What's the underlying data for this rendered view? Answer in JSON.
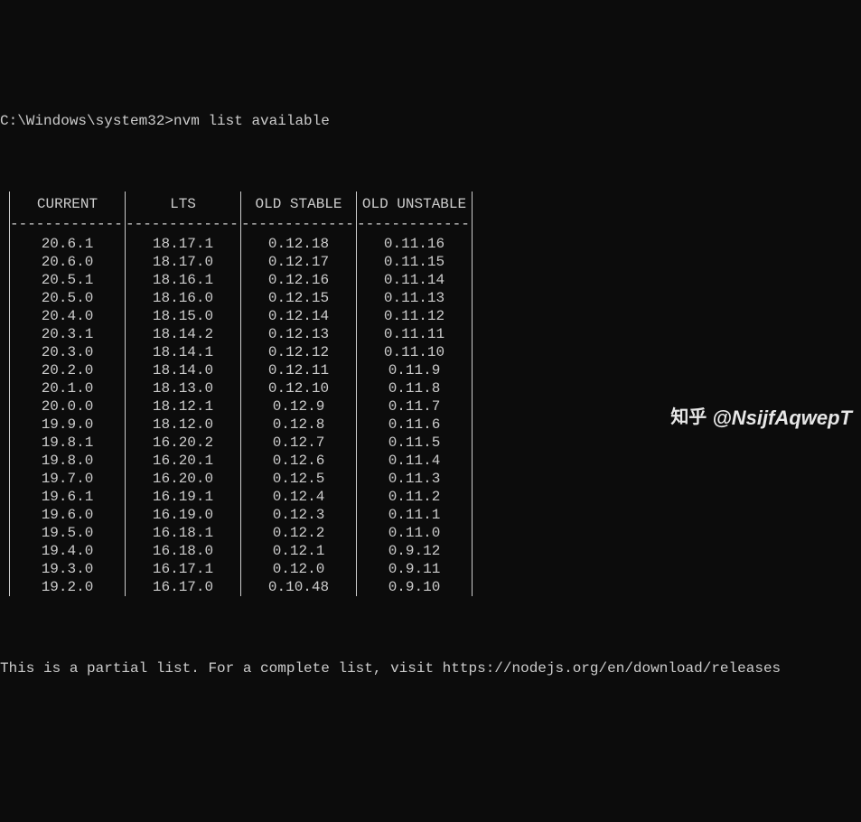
{
  "prompt": {
    "cwd": "C:\\Windows\\system32>",
    "command": "nvm list available"
  },
  "table": {
    "columns": [
      {
        "header": "CURRENT",
        "rows": [
          "20.6.1",
          "20.6.0",
          "20.5.1",
          "20.5.0",
          "20.4.0",
          "20.3.1",
          "20.3.0",
          "20.2.0",
          "20.1.0",
          "20.0.0",
          "19.9.0",
          "19.8.1",
          "19.8.0",
          "19.7.0",
          "19.6.1",
          "19.6.0",
          "19.5.0",
          "19.4.0",
          "19.3.0",
          "19.2.0"
        ]
      },
      {
        "header": "LTS",
        "rows": [
          "18.17.1",
          "18.17.0",
          "18.16.1",
          "18.16.0",
          "18.15.0",
          "18.14.2",
          "18.14.1",
          "18.14.0",
          "18.13.0",
          "18.12.1",
          "18.12.0",
          "16.20.2",
          "16.20.1",
          "16.20.0",
          "16.19.1",
          "16.19.0",
          "16.18.1",
          "16.18.0",
          "16.17.1",
          "16.17.0"
        ]
      },
      {
        "header": "OLD STABLE",
        "rows": [
          "0.12.18",
          "0.12.17",
          "0.12.16",
          "0.12.15",
          "0.12.14",
          "0.12.13",
          "0.12.12",
          "0.12.11",
          "0.12.10",
          "0.12.9",
          "0.12.8",
          "0.12.7",
          "0.12.6",
          "0.12.5",
          "0.12.4",
          "0.12.3",
          "0.12.2",
          "0.12.1",
          "0.12.0",
          "0.10.48"
        ]
      },
      {
        "header": "OLD UNSTABLE",
        "rows": [
          "0.11.16",
          "0.11.15",
          "0.11.14",
          "0.11.13",
          "0.11.12",
          "0.11.11",
          "0.11.10",
          "0.11.9",
          "0.11.8",
          "0.11.7",
          "0.11.6",
          "0.11.5",
          "0.11.4",
          "0.11.3",
          "0.11.2",
          "0.11.1",
          "0.11.0",
          "0.9.12",
          "0.9.11",
          "0.9.10"
        ]
      }
    ]
  },
  "footer": "This is a partial list. For a complete list, visit https://nodejs.org/en/download/releases",
  "watermark": {
    "logo": "知乎",
    "handle": "@NsijfAqwepT"
  }
}
